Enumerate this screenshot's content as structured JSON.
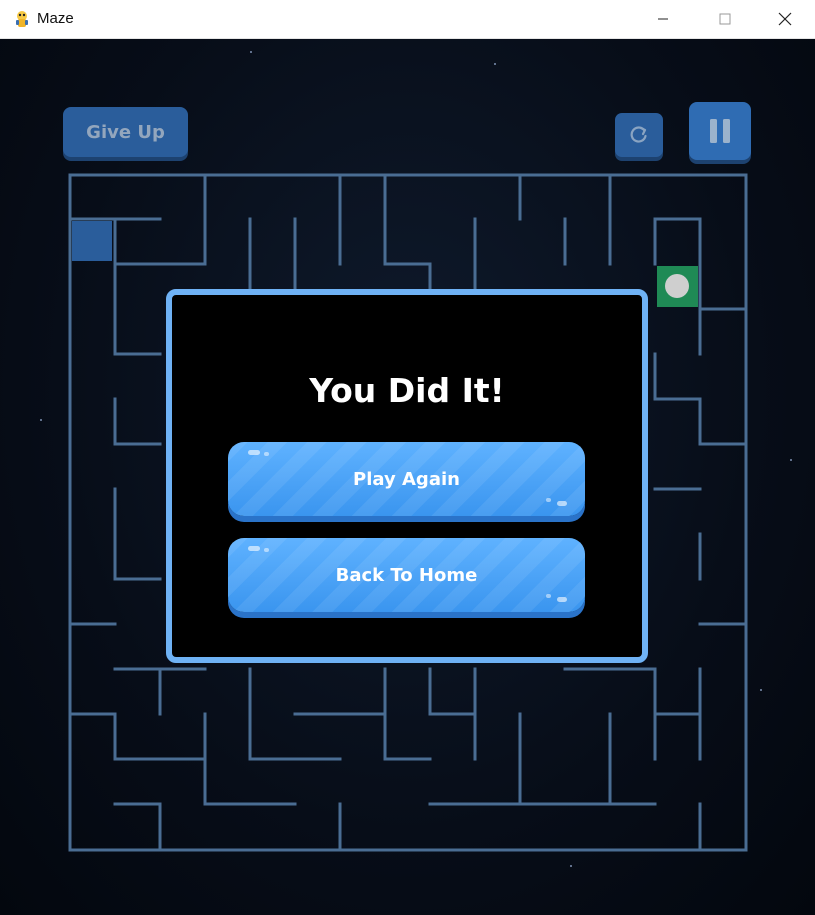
{
  "window": {
    "title": "Maze",
    "icon": "python-icon"
  },
  "hud": {
    "give_up_label": "Give Up",
    "restart_icon": "restart-icon",
    "pause_icon": "pause-icon"
  },
  "maze": {
    "wall_color": "#4a6d93",
    "player_color": "#2a5d9b",
    "goal_color": "#1f8a55",
    "goal_marker_color": "#cfcfcf"
  },
  "modal": {
    "title": "You Did It!",
    "play_again_label": "Play Again",
    "back_home_label": "Back To Home",
    "border_color": "#6fb2f5",
    "button_color": "#4aa3f7"
  }
}
